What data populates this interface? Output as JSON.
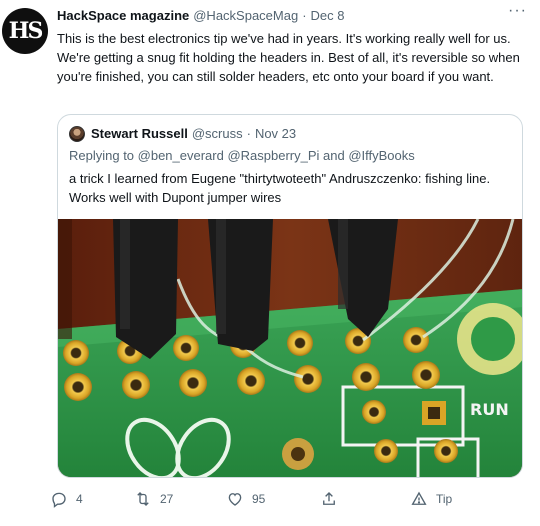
{
  "tweet": {
    "avatar_initials": "HS",
    "author_name": "HackSpace magazine",
    "author_handle": "@HackSpaceMag",
    "separator": "·",
    "date": "Dec 8",
    "text": "This is the best electronics tip we've had in years. It's working really well for us. We're getting a snug fit holding the headers in. Best of all, it's reversible so when you're finished, you can still solder headers, etc onto your board if you want."
  },
  "quoted_tweet": {
    "author_name": "Stewart Russell",
    "author_handle": "@scruss",
    "separator": "·",
    "date": "Nov 23",
    "replying_to": "Replying to @ben_everard @Raspberry_Pi and @IffyBooks",
    "text": "a trick I learned from Eugene \"thirtytwoteeth\" Andruszczenko: fishing line. Works well with Dupont jumper wires",
    "board_silkscreen": "RUN"
  },
  "actions": {
    "replies": "4",
    "retweets": "27",
    "likes": "95",
    "tip_label": "Tip"
  },
  "icons": [
    "more-icon",
    "reply-icon",
    "retweet-icon",
    "like-icon",
    "tip-icon"
  ],
  "colors": {
    "text": "#0f1419",
    "muted": "#536471",
    "border": "#cfd9de",
    "pcb_green": "#2f9a47"
  }
}
